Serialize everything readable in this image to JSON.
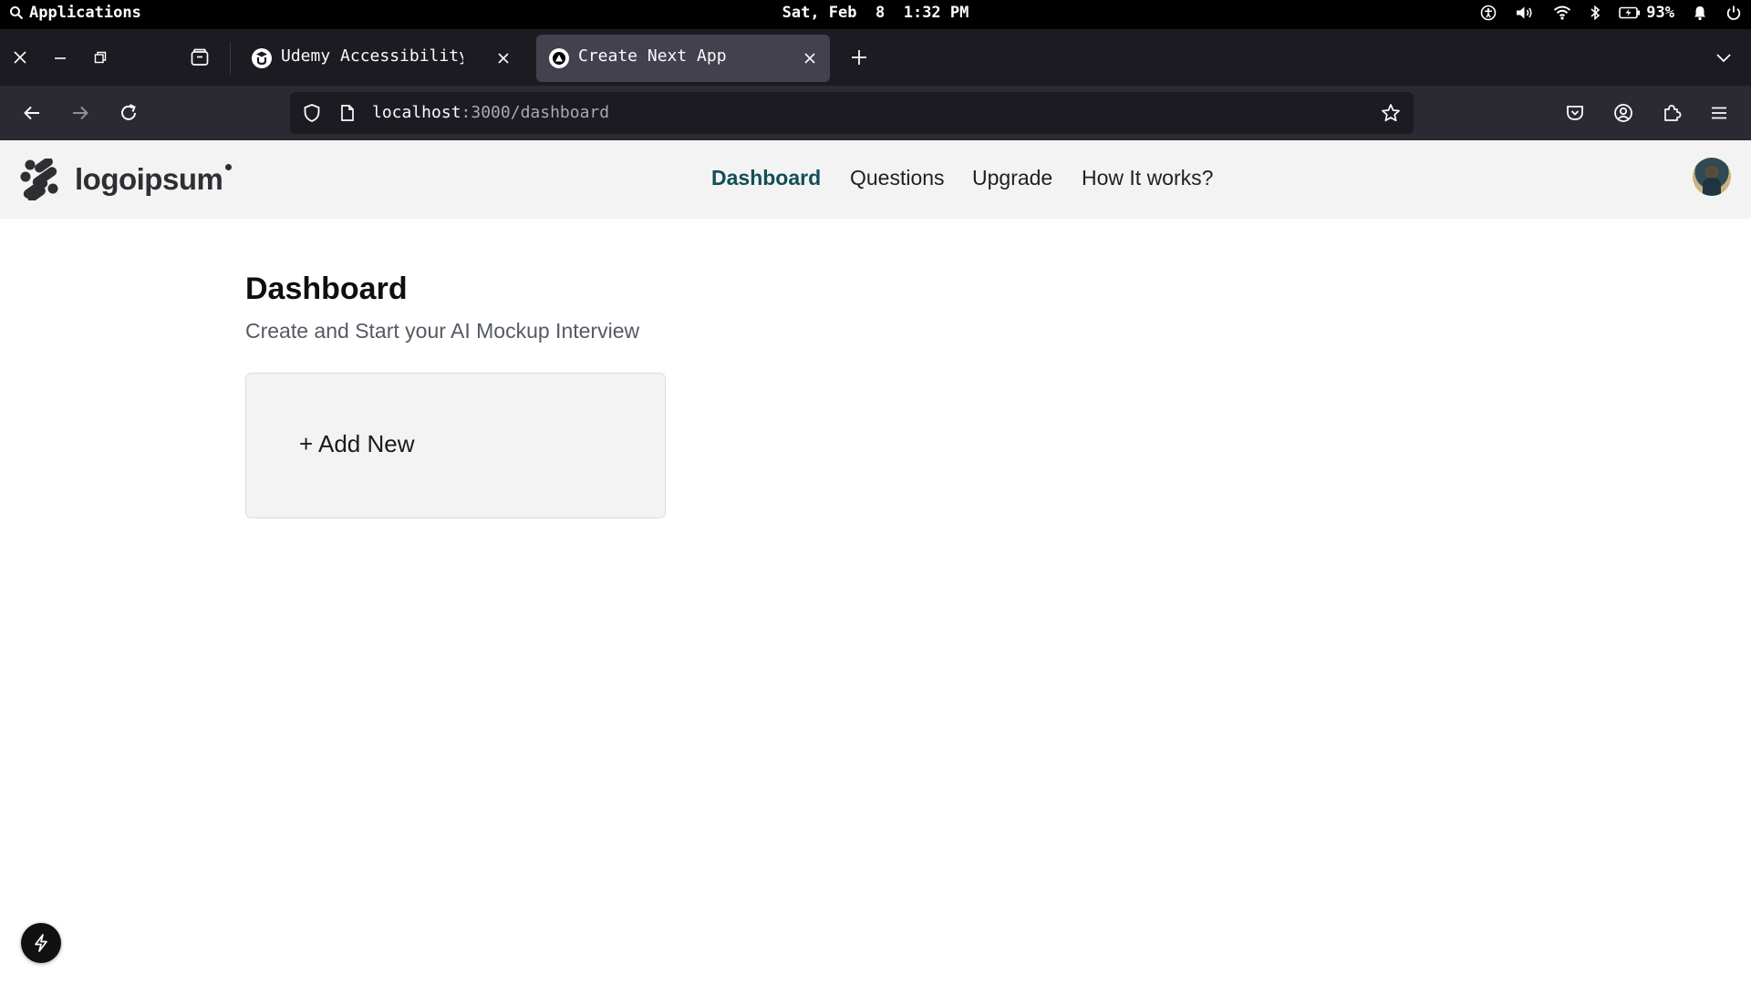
{
  "system_bar": {
    "applications_label": "Applications",
    "date": "Sat, Feb",
    "day": "8",
    "time": "1:32 PM",
    "battery_percent": "93%"
  },
  "browser": {
    "tabs": [
      {
        "title": "Udemy Accessibility Sta",
        "favicon": "udemy-icon",
        "active": false
      },
      {
        "title": "Create Next App",
        "favicon": "nextjs-triangle-icon",
        "active": true
      }
    ],
    "url": {
      "host": "localhost",
      "path": ":3000/dashboard"
    }
  },
  "site": {
    "logo_text": "logoipsum",
    "nav": [
      {
        "label": "Dashboard",
        "active": true
      },
      {
        "label": "Questions",
        "active": false
      },
      {
        "label": "Upgrade",
        "active": false
      },
      {
        "label": "How It works?",
        "active": false
      }
    ]
  },
  "main": {
    "title": "Dashboard",
    "subtitle": "Create and Start your AI Mockup Interview",
    "add_card_label": "+ Add New"
  },
  "colors": {
    "accent": "#134e56",
    "header_bg": "#f3f3f3",
    "browser_chrome": "#2b2a33"
  }
}
